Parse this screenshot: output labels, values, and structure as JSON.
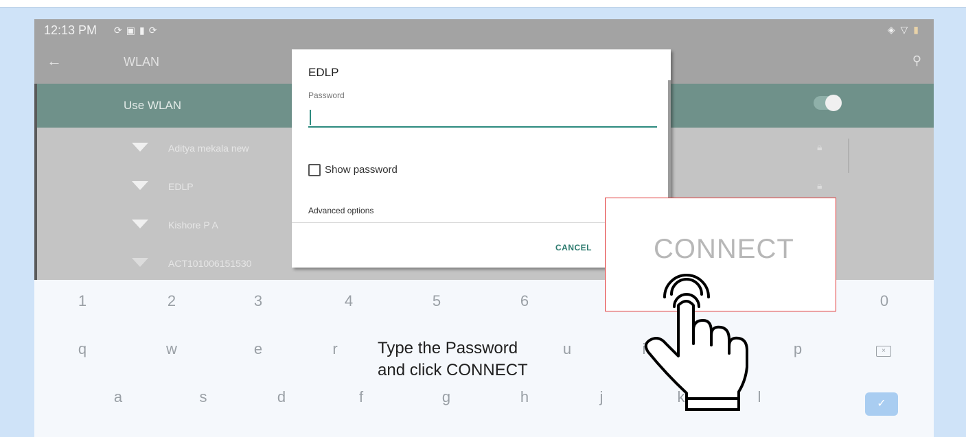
{
  "status_bar": {
    "time": "12:13 PM",
    "left_icons": [
      "sync-icon",
      "image-icon",
      "lock-icon",
      "sync-icon"
    ],
    "right_icons": [
      "vibrate-icon",
      "wifi-icon",
      "battery-icon"
    ]
  },
  "app_bar": {
    "title": "WLAN"
  },
  "use_wlan": {
    "label": "Use WLAN",
    "enabled": true
  },
  "networks": [
    {
      "name": "Aditya mekala  new",
      "secured": true
    },
    {
      "name": "EDLP",
      "secured": true
    },
    {
      "name": "Kishore P A",
      "secured": false
    },
    {
      "name": "ACT101006151530",
      "secured": false
    }
  ],
  "dialog": {
    "title": "EDLP",
    "password_label": "Password",
    "password_value": "",
    "show_password_label": "Show password",
    "advanced_options_label": "Advanced options",
    "cancel_label": "CANCEL",
    "connect_label": "CONNECT"
  },
  "keyboard": {
    "row_numbers": [
      "1",
      "2",
      "3",
      "4",
      "5",
      "6",
      "0"
    ],
    "row_top": [
      "q",
      "w",
      "e",
      "r",
      "u",
      "i",
      "o",
      "p"
    ],
    "row_home": [
      "a",
      "s",
      "d",
      "f",
      "g",
      "h",
      "j",
      "k",
      "l"
    ]
  },
  "overlay": {
    "caption_line1": "Type the Password",
    "caption_line2": "and click CONNECT",
    "accent_color": "#e03030"
  }
}
